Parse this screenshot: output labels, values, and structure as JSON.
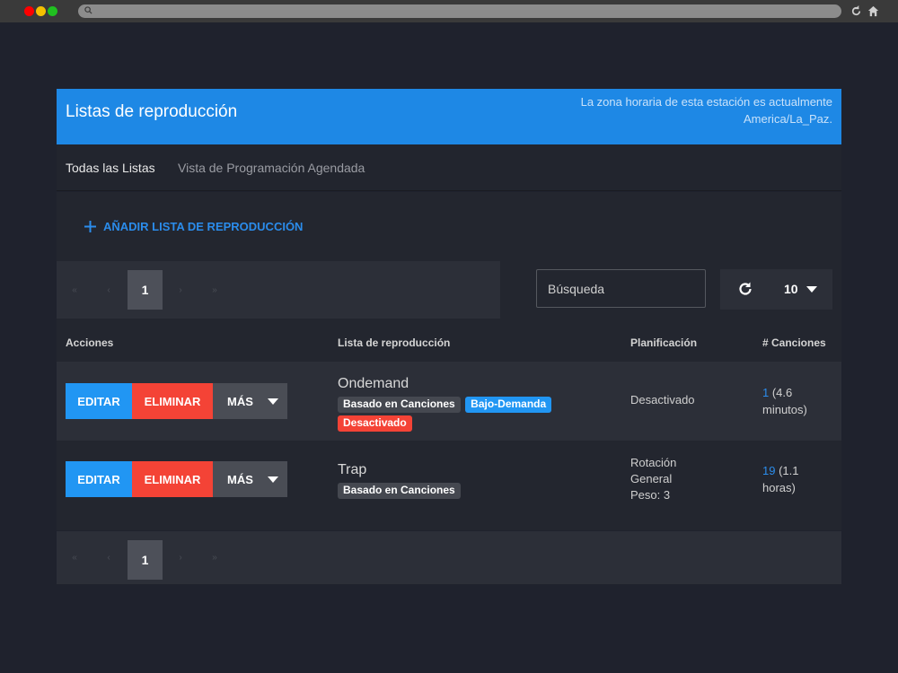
{
  "header": {
    "title": "Listas de reproducción",
    "timezone_line1": "La zona horaria de esta estación es actualmente",
    "timezone_line2": "America/La_Paz."
  },
  "tabs": [
    {
      "label": "Todas las Listas",
      "active": true
    },
    {
      "label": "Vista de Programación Agendada",
      "active": false
    }
  ],
  "add_button": {
    "label": "AÑADIR LISTA DE REPRODUCCIÓN",
    "icon": "plus-icon"
  },
  "pagination": {
    "first": "«",
    "prev": "‹",
    "current_page": "1",
    "next": "›",
    "last": "»"
  },
  "search": {
    "placeholder": "Búsqueda",
    "value": ""
  },
  "per_page": {
    "value": "10",
    "refresh_icon": "refresh-icon"
  },
  "table": {
    "columns": [
      "Acciones",
      "Lista de reproducción",
      "Planificación",
      "# Canciones"
    ],
    "rows": [
      {
        "actions": {
          "edit": "EDITAR",
          "delete": "ELIMINAR",
          "more": "MÁS"
        },
        "name": "Ondemand",
        "badges": [
          {
            "label": "Basado en Canciones",
            "color": "#454850"
          },
          {
            "label": "Bajo-Demanda",
            "color": "#2196f3"
          },
          {
            "label": "Desactivado",
            "color": "#f44336"
          }
        ],
        "schedule": [
          "Desactivado"
        ],
        "song_count": "1",
        "duration_line1": " (4.6",
        "duration_line2": "minutos)"
      },
      {
        "actions": {
          "edit": "EDITAR",
          "delete": "ELIMINAR",
          "more": "MÁS"
        },
        "name": "Trap",
        "badges": [
          {
            "label": "Basado en Canciones",
            "color": "#454850"
          }
        ],
        "schedule": [
          "Rotación",
          "General",
          "Peso: 3"
        ],
        "song_count": "19",
        "duration_line1": " (1.1",
        "duration_line2": "horas)"
      }
    ]
  },
  "colors": {
    "accent": "#1e88e5",
    "danger": "#f44336",
    "background": "#1f222d"
  }
}
